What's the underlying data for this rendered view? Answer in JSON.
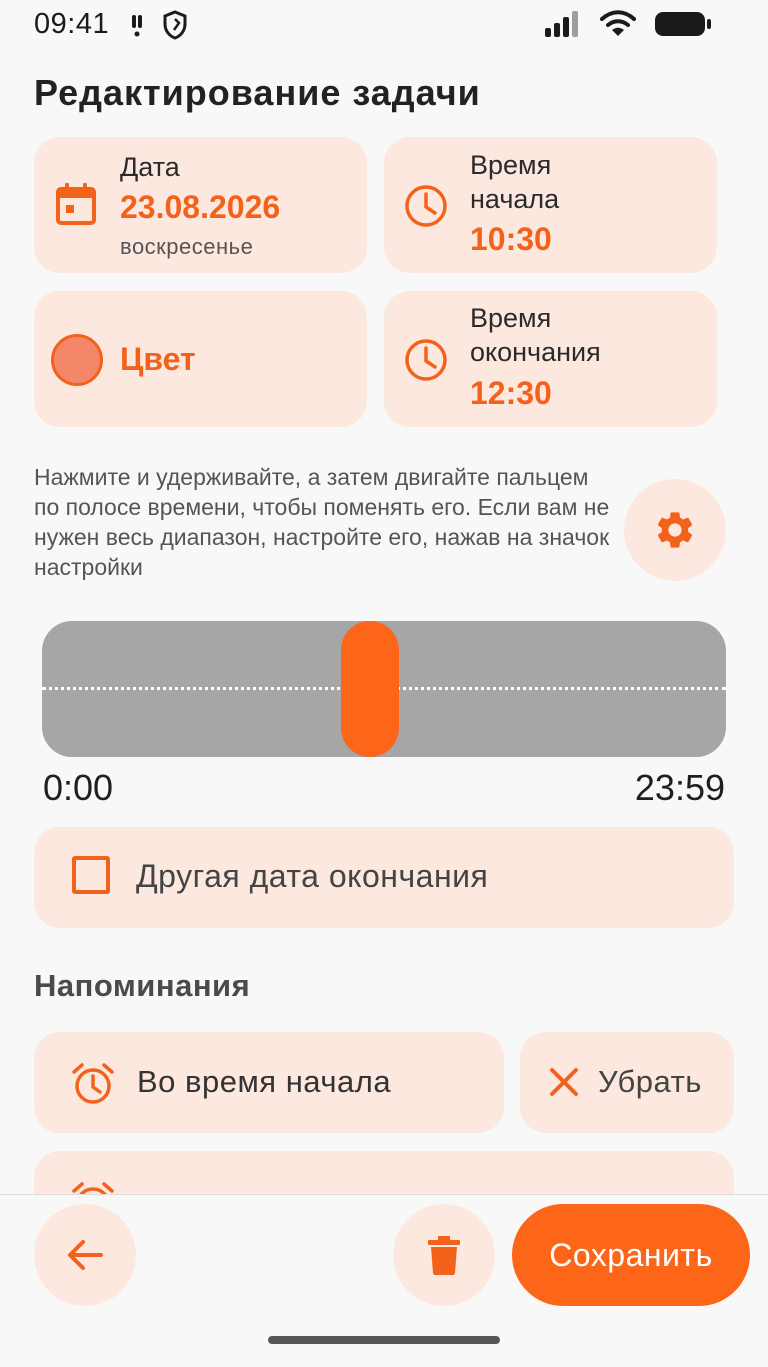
{
  "status_bar": {
    "time": "09:41"
  },
  "page_title": "Редактирование задачи",
  "date_card": {
    "label": "Дата",
    "value": "23.08.2026",
    "weekday": "воскресенье"
  },
  "start_time_card": {
    "label_line1": "Время",
    "label_line2": "начала",
    "value": "10:30"
  },
  "color_card": {
    "label": "Цвет",
    "swatch_color": "#f4876a"
  },
  "end_time_card": {
    "label_line1": "Время",
    "label_line2": "окончания",
    "value": "12:30"
  },
  "hint_text": "Нажмите и удерживайте, а затем двигайте пальцем по полосе времени, чтобы поменять его. Если вам не нужен весь диапазон, настройте его, нажав на значок настройки",
  "timebar": {
    "start_label": "0:00",
    "end_label": "23:59"
  },
  "end_date_checkbox": {
    "label": "Другая дата окончания",
    "checked": false
  },
  "reminders": {
    "title": "Напоминания",
    "items": [
      {
        "label": "Во время начала"
      }
    ],
    "remove_label": "Убрать"
  },
  "bottom_bar": {
    "save_label": "Сохранить"
  },
  "colors": {
    "accent": "#fd6518",
    "accent_text": "#f2621b",
    "card_bg": "#fde8df",
    "timebar_bg": "#a6a6a6",
    "page_bg": "#f8f8f8"
  },
  "icons": [
    "alert-icon",
    "shield-icon",
    "signal-icon",
    "wifi-icon",
    "battery-icon",
    "calendar-icon",
    "clock-icon",
    "gear-icon",
    "alarm-icon",
    "close-icon",
    "back-arrow-icon",
    "trash-icon"
  ]
}
